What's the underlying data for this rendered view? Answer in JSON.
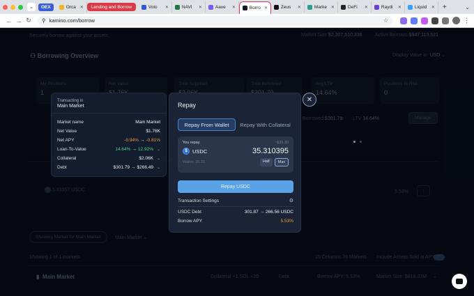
{
  "browser": {
    "tabs": [
      {
        "label": "OEX",
        "kind": "badge"
      },
      {
        "label": "Orca",
        "color": "#f0b429"
      },
      {
        "label": "Lending and Borrow",
        "kind": "group"
      },
      {
        "label": "Volo",
        "color": "#2f5bd3"
      },
      {
        "label": "NAVI",
        "color": "#1f7a3f"
      },
      {
        "label": "Aave",
        "color": "#7a5af8"
      },
      {
        "label": "Borro",
        "color": "#101828",
        "active": true
      },
      {
        "label": "Zeus",
        "color": "#111111"
      },
      {
        "label": "Marke",
        "color": "#2a9d8f"
      },
      {
        "label": "DeFi",
        "color": "#222222"
      },
      {
        "label": "Raydi",
        "color": "#6b3fd4"
      },
      {
        "label": "Liquid",
        "color": "#3aa0ff"
      }
    ],
    "url": "kamino.com/borrow"
  },
  "background": {
    "tagline": "Securely borrow against your assets.",
    "market_size_label": "Market Size",
    "market_size_value": "$2,307,610,336",
    "active_borrows_label": "Active Borrows",
    "active_borrows_value": "$947,113,521",
    "overview_title": "Borrowing Overview",
    "display_value_label": "Display Value in:",
    "display_value_currency": "USD",
    "stats": [
      {
        "label": "My Positions",
        "value": "1"
      },
      {
        "label": "Net Value",
        "value": "$1.76K"
      },
      {
        "label": "Total Supplied",
        "value": "$2.06K"
      },
      {
        "label": "Total Borrowed",
        "value": "$301.79"
      },
      {
        "label": "Avg LTV",
        "value": "14.64%"
      },
      {
        "label": "Positions At Risk",
        "value": "0"
      }
    ],
    "borrowed_label": "Borrowed",
    "borrowed_value": "$301.79",
    "ltv_label": "LTV",
    "ltv_value": "14.64%",
    "manage_label": "Manage",
    "row_amount": "5.83357",
    "row_token": "USDC",
    "row_apy": "5.53%",
    "showing_market": "Showing Market for Main Market",
    "main_market_dropdown": "Main Market",
    "showing_count": "Showing 1 of 1 markets",
    "columns_label": "25 Columns 39 Markets",
    "include_label": "Include Assets Sold in APY",
    "market_row_name": "Main Market",
    "market_row_collateral": "Collateral",
    "market_row_collateral_value": "+1 SOL +20",
    "market_row_debt": "Debt",
    "market_row_apy": "Borrow APY: 5.53%",
    "market_row_size": "Market Size: $818.03M"
  },
  "info_panel": {
    "transacting_in": "Transacting in",
    "market_title": "Main Market",
    "rows": [
      {
        "label": "Market name",
        "value": "Main Market"
      },
      {
        "label": "Net Value",
        "value": "$1.76K"
      },
      {
        "label": "Net APY",
        "from": "-0.94%",
        "to": "-0.81%"
      },
      {
        "label": "Loan-To-Value",
        "from": "14.64%",
        "to": "12.92%"
      },
      {
        "label": "Collateral",
        "value": "$2.06K"
      },
      {
        "label": "Debt",
        "from": "$301.79",
        "to": "$266.49"
      }
    ]
  },
  "modal": {
    "title": "Repay",
    "tab_wallet": "Repay From Wallet",
    "tab_collateral": "Repay With Collateral",
    "you_repay": "You repay",
    "balance_hint": "~$35.30",
    "token": "USDC",
    "amount": "35.310395",
    "wallet_hint": "Wallet: 35.31",
    "half": "Half",
    "max": "Max",
    "repay_button": "Repay USDC",
    "settings_label": "Transaction Settings",
    "usdc_debt_label": "USDC Debt",
    "usdc_debt_value": "301.87 → 266.56 USDC",
    "borrow_apy_label": "Borrow APY",
    "borrow_apy_value": "5.53%"
  },
  "icons": {
    "close": "close-icon",
    "gear": "gear-icon",
    "chat": "chat-icon"
  }
}
